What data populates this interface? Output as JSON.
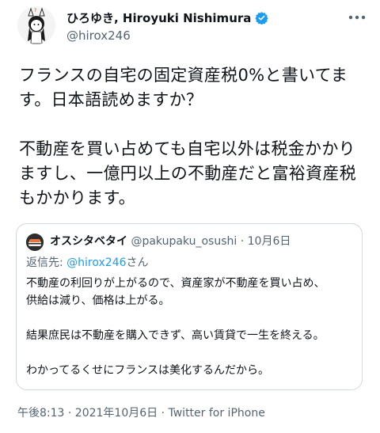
{
  "author": {
    "name": "ひろゆき, Hiroyuki Nishimura",
    "handle": "@hirox246",
    "verified": true
  },
  "tweet": {
    "text": "フランスの自宅の固定資産税0%と書いてます。日本語読めますか？\n\n不動産を買い占めても自宅以外は税金かかりますし、一億円以上の不動産だと富裕資産税もかかります。"
  },
  "quoted_tweet": {
    "author_name": "オスシタベタイ",
    "handle_date": "@pakupaku_osushi · 10月6日",
    "reply_prefix": "返信先: ",
    "reply_mention": "@hirox246",
    "reply_suffix": "さん",
    "text": "不動産の利回りが上がるので、資産家が不動産を買い占め、\n供給は減り、価格は上がる。\n\n結果庶民は不動産を購入できず、高い賃貸で一生を終える。\n\nわかってるくせにフランスは美化するんだから。"
  },
  "meta": {
    "timestamp": "午後8:13 · 2021年10月6日 · Twitter for iPhone"
  },
  "colors": {
    "text": "#0f1419",
    "secondary": "#536471",
    "link": "#1d9bf0",
    "border": "#cfd9de",
    "verified": "#1d9bf0"
  }
}
